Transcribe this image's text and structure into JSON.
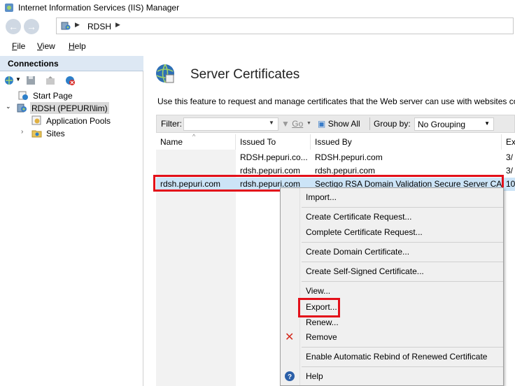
{
  "window": {
    "title": "Internet Information Services (IIS) Manager"
  },
  "address_bar": {
    "crumbs": [
      "RDSH"
    ]
  },
  "menu": {
    "items": [
      {
        "label": "File",
        "accel": "F",
        "rest": "ile"
      },
      {
        "label": "View",
        "accel": "V",
        "rest": "iew"
      },
      {
        "label": "Help",
        "accel": "H",
        "rest": "elp"
      }
    ]
  },
  "connections": {
    "header": "Connections",
    "tree": [
      {
        "label": "Start Page"
      },
      {
        "label": "RDSH (PEPURI\\lim)"
      },
      {
        "label": "Application Pools"
      },
      {
        "label": "Sites"
      }
    ]
  },
  "feature": {
    "title": "Server Certificates",
    "description": "Use this feature to request and manage certificates that the Web server can use with websites con"
  },
  "filterbar": {
    "filter_label": "Filter:",
    "go_label": "Go",
    "show_all_label": "Show All",
    "group_by_label": "Group by:",
    "group_by_value": "No Grouping"
  },
  "table": {
    "columns": [
      "Name",
      "Issued To",
      "Issued By",
      "Ex"
    ],
    "rows": [
      {
        "name": "",
        "issued_to": "RDSH.pepuri.co...",
        "issued_by": "RDSH.pepuri.com",
        "exp": "3/"
      },
      {
        "name": "",
        "issued_to": "rdsh.pepuri.com",
        "issued_by": "rdsh.pepuri.com",
        "exp": "3/"
      },
      {
        "name": "rdsh.pepuri.com",
        "issued_to": "rdsh.pepuri.com",
        "issued_by": "Sectigo RSA Domain Validation Secure Server CA",
        "exp": "10"
      }
    ]
  },
  "context_menu": {
    "items": [
      "Import...",
      "Create Certificate Request...",
      "Complete Certificate Request...",
      "Create Domain Certificate...",
      "Create Self-Signed Certificate...",
      "View...",
      "Export...",
      "Renew...",
      "Remove",
      "Enable Automatic Rebind of Renewed Certificate",
      "Help"
    ]
  },
  "colors": {
    "highlight_red": "#e3101a",
    "selection_blue": "#cce4f7",
    "header_blue": "#dde8f4"
  }
}
